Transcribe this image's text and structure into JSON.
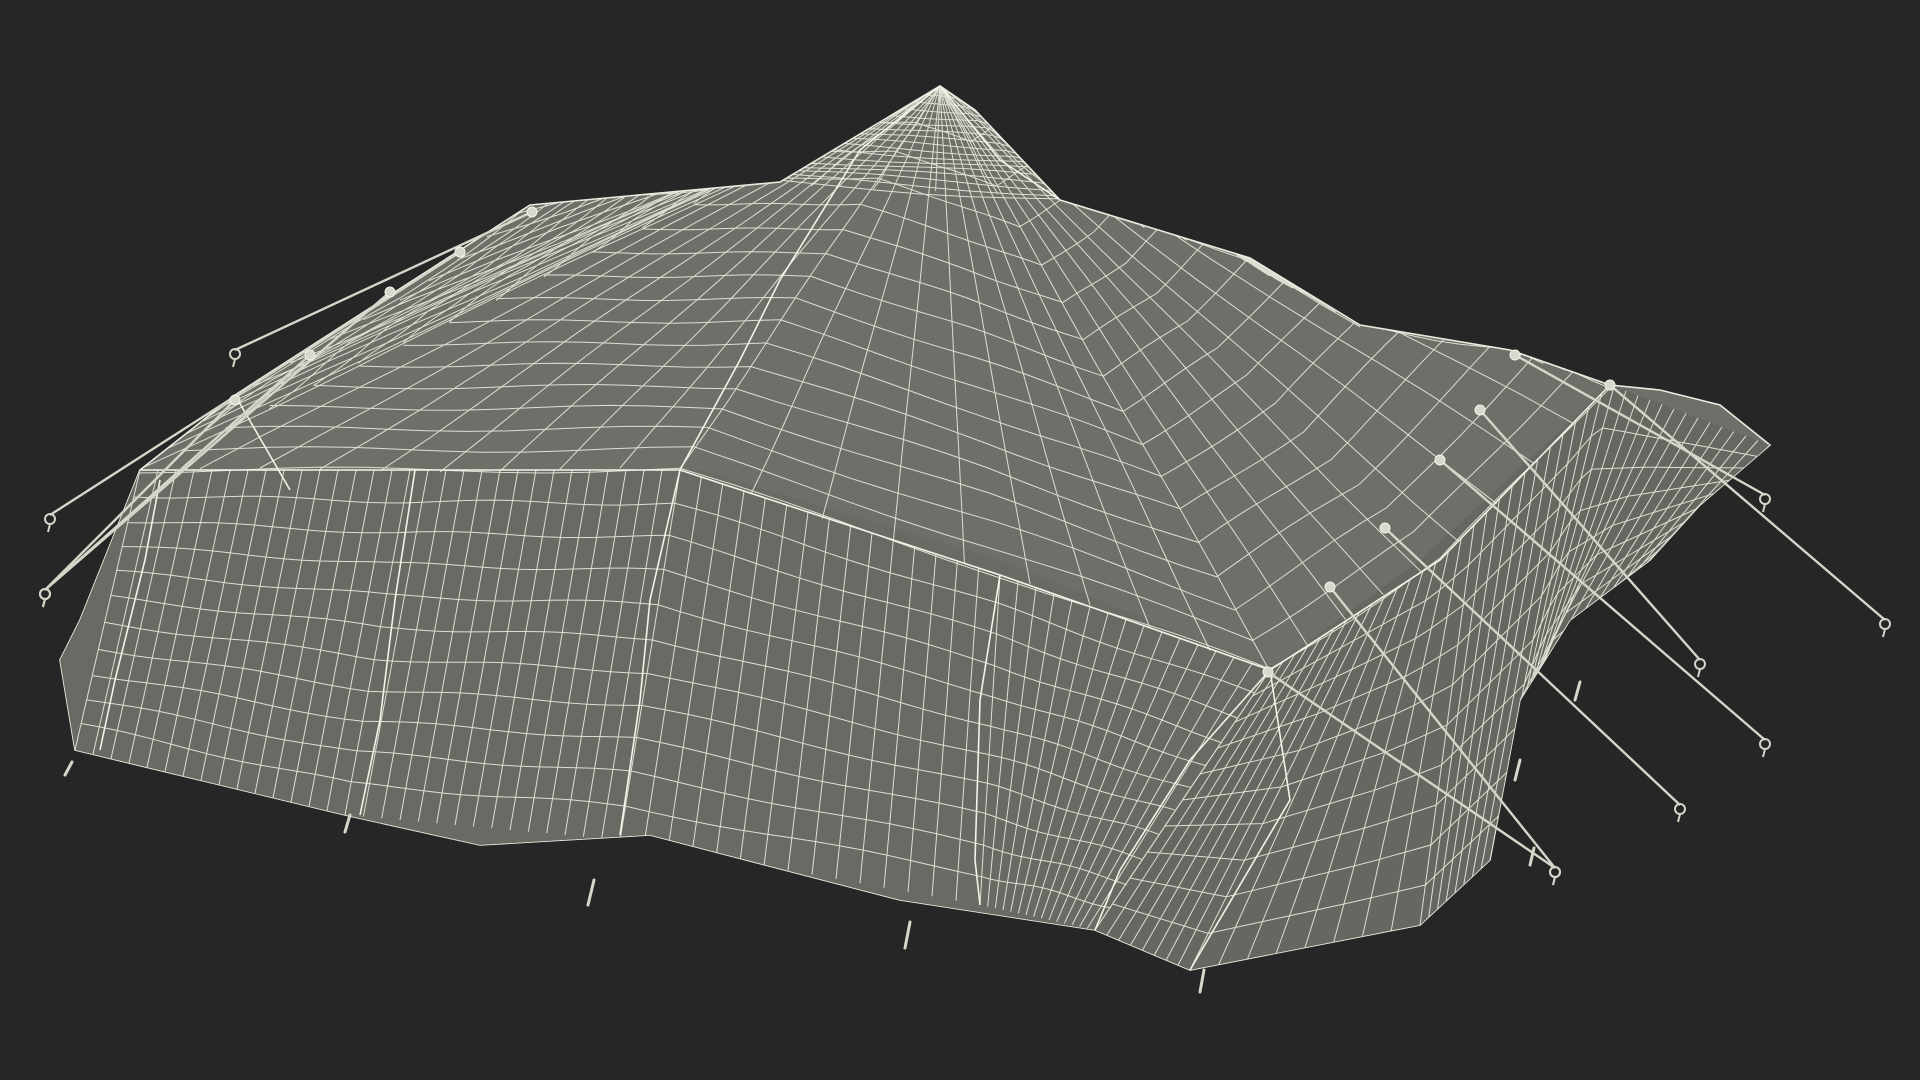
{
  "scene": {
    "subject": "tent-wireframe",
    "render_mode": "wireframe",
    "background_color": "#262626",
    "surface_color": "#6f6f69",
    "surface_shadow_color": "#5f5f5a",
    "wire_color": "#ecebe0",
    "wire_seam_color": "#f4f3ea"
  }
}
